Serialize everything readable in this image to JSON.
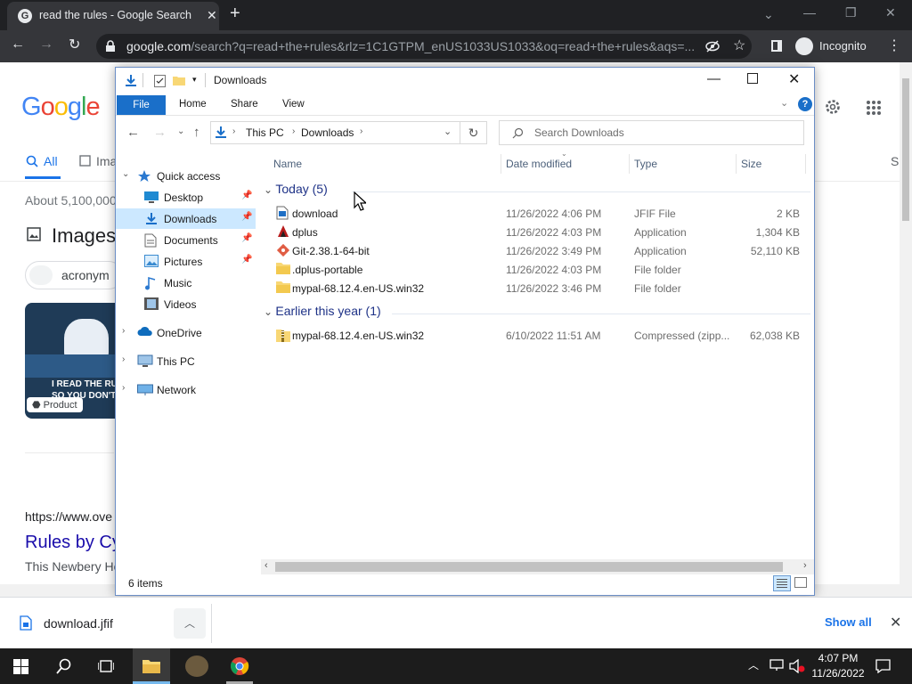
{
  "browser": {
    "tab_title": "read the rules - Google Search",
    "url_host": "google.com",
    "url_path": "/search?q=read+the+rules&rlz=1C1GTPM_enUS1033US1033&oq=read+the+rules&aqs=...",
    "incognito_label": "Incognito"
  },
  "google": {
    "logo_letters": [
      "G",
      "o",
      "o",
      "g",
      "l",
      "e"
    ],
    "logo_colors": [
      "#4285f4",
      "#ea4335",
      "#fbbc05",
      "#4285f4",
      "#34a853",
      "#ea4335"
    ],
    "tab_all": "All",
    "tab_images": "Ima",
    "about": "About 5,100,000",
    "images_heading": "Images",
    "chip": "acronym",
    "card_caption_1": "I READ THE RULES",
    "card_caption_2": "SO YOU DON'T HAVE",
    "product_badge": "Product",
    "right_tab": "S",
    "cite": "https://www.ove",
    "link": "Rules by Cy",
    "snippet": "This Newbery Ho"
  },
  "explorer": {
    "title": "Downloads",
    "ribbon_tabs": [
      "File",
      "Home",
      "Share",
      "View"
    ],
    "breadcrumb": [
      "This PC",
      "Downloads"
    ],
    "search_placeholder": "Search Downloads",
    "nav": [
      {
        "label": "Quick access",
        "icon": "star-icon",
        "level": 0,
        "expandable": true,
        "pinned": false
      },
      {
        "label": "Desktop",
        "icon": "desktop-icon",
        "level": 1,
        "pinned": true
      },
      {
        "label": "Downloads",
        "icon": "download-arrow-icon",
        "level": 1,
        "pinned": true,
        "selected": true
      },
      {
        "label": "Documents",
        "icon": "documents-icon",
        "level": 1,
        "pinned": true
      },
      {
        "label": "Pictures",
        "icon": "pictures-icon",
        "level": 1,
        "pinned": true
      },
      {
        "label": "Music",
        "icon": "music-icon",
        "level": 1,
        "pinned": false
      },
      {
        "label": "Videos",
        "icon": "videos-icon",
        "level": 1,
        "pinned": false
      },
      {
        "label": "OneDrive",
        "icon": "cloud-icon",
        "level": 0,
        "expandable": true
      },
      {
        "label": "This PC",
        "icon": "computer-icon",
        "level": 0,
        "expandable": true
      },
      {
        "label": "Network",
        "icon": "network-icon",
        "level": 0,
        "expandable": true
      }
    ],
    "columns": {
      "name": "Name",
      "date": "Date modified",
      "type": "Type",
      "size": "Size"
    },
    "groups": [
      {
        "label": "Today (5)",
        "files": [
          {
            "name": "download",
            "date": "11/26/2022 4:06 PM",
            "type": "JFIF File",
            "size": "2 KB",
            "icon": "image-file-icon"
          },
          {
            "name": "dplus",
            "date": "11/26/2022 4:03 PM",
            "type": "Application",
            "size": "1,304 KB",
            "icon": "app-icon"
          },
          {
            "name": "Git-2.38.1-64-bit",
            "date": "11/26/2022 3:49 PM",
            "type": "Application",
            "size": "52,110 KB",
            "icon": "git-icon"
          },
          {
            "name": ".dplus-portable",
            "date": "11/26/2022 4:03 PM",
            "type": "File folder",
            "size": "",
            "icon": "folder-icon"
          },
          {
            "name": "mypal-68.12.4.en-US.win32",
            "date": "11/26/2022 3:46 PM",
            "type": "File folder",
            "size": "",
            "icon": "folder-icon"
          }
        ]
      },
      {
        "label": "Earlier this year (1)",
        "files": [
          {
            "name": "mypal-68.12.4.en-US.win32",
            "date": "6/10/2022 11:51 AM",
            "type": "Compressed (zipp...",
            "size": "62,038 KB",
            "icon": "zip-folder-icon"
          }
        ]
      }
    ],
    "status": "6 items"
  },
  "download_bar": {
    "filename": "download.jfif",
    "show_all": "Show all"
  },
  "taskbar": {
    "time": "4:07 PM",
    "date": "11/26/2022"
  }
}
